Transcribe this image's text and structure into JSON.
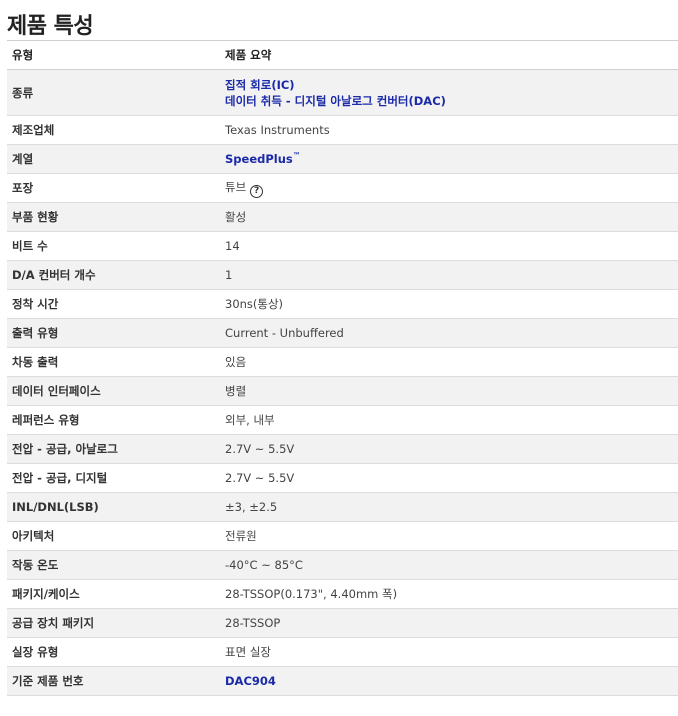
{
  "page_title": "제품 특성",
  "table": {
    "col_label": "유형",
    "col_value": "제품 요약",
    "rows": [
      {
        "label": "종류",
        "value_line1": "집적 회로(IC)",
        "value_line2": "데이터 취득 - 디지털 아날로그 컨버터(DAC)"
      },
      {
        "label": "제조업체",
        "value": "Texas Instruments"
      },
      {
        "label": "계열",
        "value": "SpeedPlus",
        "tm": "™"
      },
      {
        "label": "포장",
        "value": "튜브",
        "help": "?"
      },
      {
        "label": "부품 현황",
        "value": "활성"
      },
      {
        "label": "비트 수",
        "value": "14"
      },
      {
        "label": "D/A 컨버터 개수",
        "value": "1"
      },
      {
        "label": "정착 시간",
        "value": "30ns(통상)"
      },
      {
        "label": "출력 유형",
        "value": "Current - Unbuffered"
      },
      {
        "label": "차동 출력",
        "value": "있음"
      },
      {
        "label": "데이터 인터페이스",
        "value": "병렬"
      },
      {
        "label": "레퍼런스 유형",
        "value": "외부, 내부"
      },
      {
        "label": "전압 - 공급, 아날로그",
        "value": "2.7V ~ 5.5V"
      },
      {
        "label": "전압 - 공급, 디지털",
        "value": "2.7V ~ 5.5V"
      },
      {
        "label": "INL/DNL(LSB)",
        "value": "±3, ±2.5"
      },
      {
        "label": "아키텍처",
        "value": "전류원"
      },
      {
        "label": "작동 온도",
        "value": "-40°C ~ 85°C"
      },
      {
        "label": "패키지/케이스",
        "value": "28-TSSOP(0.173\", 4.40mm 폭)"
      },
      {
        "label": "공급 장치 패키지",
        "value": "28-TSSOP"
      },
      {
        "label": "실장 유형",
        "value": "표면 실장"
      },
      {
        "label": "기준 제품 번호",
        "value": "DAC904"
      }
    ]
  }
}
